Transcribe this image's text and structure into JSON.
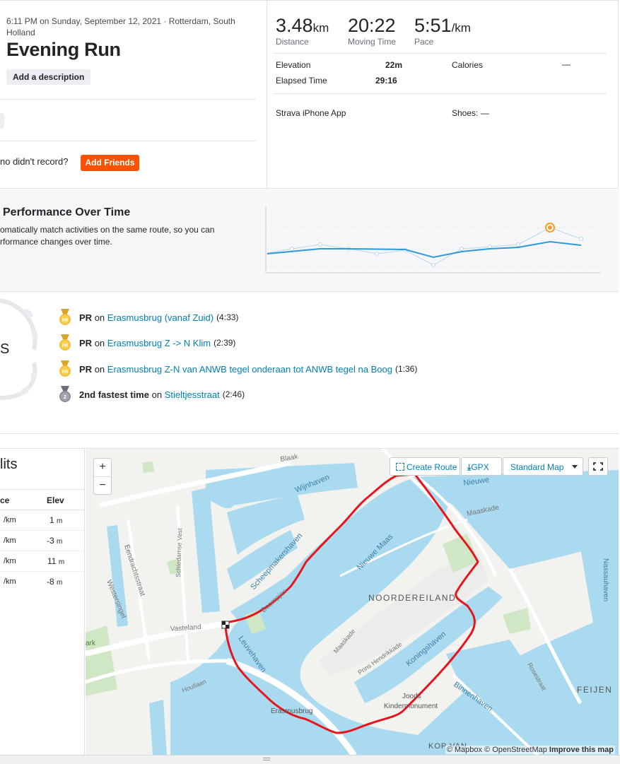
{
  "activity": {
    "meta": "6:11 PM on Sunday, September 12, 2021 · Rotterdam, South Holland",
    "title": "Evening Run",
    "add_description": "Add a description",
    "friends_question": "no didn't record?",
    "add_friends": "Add Friends"
  },
  "stats": {
    "distance_value": "3.48",
    "distance_unit": "km",
    "distance_label": "Distance",
    "moving_time_value": "20:22",
    "moving_time_label": "Moving Time",
    "pace_value": "5:51",
    "pace_unit": "/km",
    "pace_label": "Pace",
    "elevation_label": "Elevation",
    "elevation_value": "22m",
    "calories_label": "Calories",
    "calories_value": "—",
    "elapsed_label": "Elapsed Time",
    "elapsed_value": "29:16",
    "device": "Strava iPhone App",
    "shoes": "Shoes: —"
  },
  "performance": {
    "title": "Performance Over Time",
    "description": "omatically match activities on the same route, so you can\nrformance changes over time.",
    "colors": {
      "line": "#2e9bd8",
      "highlight": "#fc9a28"
    }
  },
  "achievements": {
    "partial_label": "S",
    "items": [
      {
        "medal": "gold-pr-medal-icon",
        "prefix": "PR",
        "on": "on",
        "segment": "Erasmusbrug (vanaf Zuid)",
        "time": "(4:33)"
      },
      {
        "medal": "gold-pr-medal-icon",
        "prefix": "PR",
        "on": "on",
        "segment": "Erasmusbrug Z -> N Klim",
        "time": "(2:39)"
      },
      {
        "medal": "gold-pr-medal-icon",
        "prefix": "PR",
        "on": "on",
        "segment": "Erasmusbrug Z-N van ANWB tegel onderaan tot ANWB tegel na Boog",
        "time": "(1:36)"
      },
      {
        "medal": "silver-2-medal-icon",
        "prefix": "2nd fastest time",
        "on": "on",
        "segment": "Stieltjesstraat",
        "time": "(2:46)"
      }
    ]
  },
  "splits": {
    "title": "lits",
    "col_pace": "ce",
    "col_elev": "Elev",
    "rows": [
      {
        "pace": "/km",
        "elev": "1",
        "unit": "m"
      },
      {
        "pace": "/km",
        "elev": "-3",
        "unit": "m"
      },
      {
        "pace": "/km",
        "elev": "11",
        "unit": "m"
      },
      {
        "pace": "/km",
        "elev": "-8",
        "unit": "m"
      }
    ]
  },
  "map": {
    "create_route": "Create Route",
    "gpx": "GPX",
    "map_style": "Standard Map",
    "zoom_in": "+",
    "zoom_out": "−",
    "attribution": "© Mapbox © OpenStreetMap",
    "improve": "Improve this map",
    "route_color": "#e8141b",
    "water_color": "#aadaf0",
    "labels": {
      "blaak": "Blaak",
      "wijnhaven": "Wijnhaven",
      "nieuwe": "Nieuwe",
      "maaskade_n": "Maaskade",
      "nieuwe_maas": "Nieuwe Maas",
      "scheepmakershaven": "Scheepmakershaven",
      "boompjes": "Boompjes",
      "noordereiland": "NOORDEREILAND",
      "vasteland": "Vasteland",
      "leuvehaven": "Leuvehaven",
      "maaskade_s": "Maaskade",
      "prins_hendrikkade": "Prins Hendrikkade",
      "koningshaven": "Koningshaven",
      "binnenhaven": "Binnenhaven",
      "rosestraat": "Rosestraat",
      "feijen": "FEIJEN",
      "nassauhaven": "Nassauhaven",
      "eendrachtsstraat": "Eendrachtsstraat",
      "westersingel": "Westersingel",
      "schiedamse_vest": "Schiedamse Vest",
      "houtlaan": "Houtlaan",
      "park": "ark",
      "erasmusbrug": "Erasmusbrug",
      "joods": "Joods",
      "kindermonument": "Kindermonument",
      "kop": "KOP VAN"
    }
  }
}
